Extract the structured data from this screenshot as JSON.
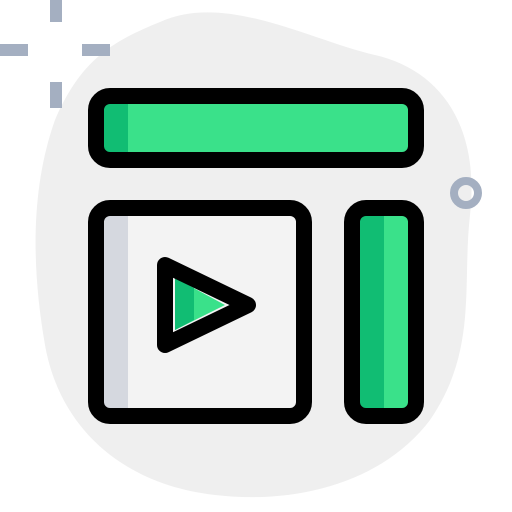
{
  "icon": {
    "name": "video-layout-icon",
    "colors": {
      "blob": "#efefef",
      "outline": "#000000",
      "green": "#3ae18a",
      "green_shade": "#11bd73",
      "panel": "#f3f3f3",
      "panel_shade": "#d5d8df",
      "accent": "#a4afc1"
    }
  }
}
